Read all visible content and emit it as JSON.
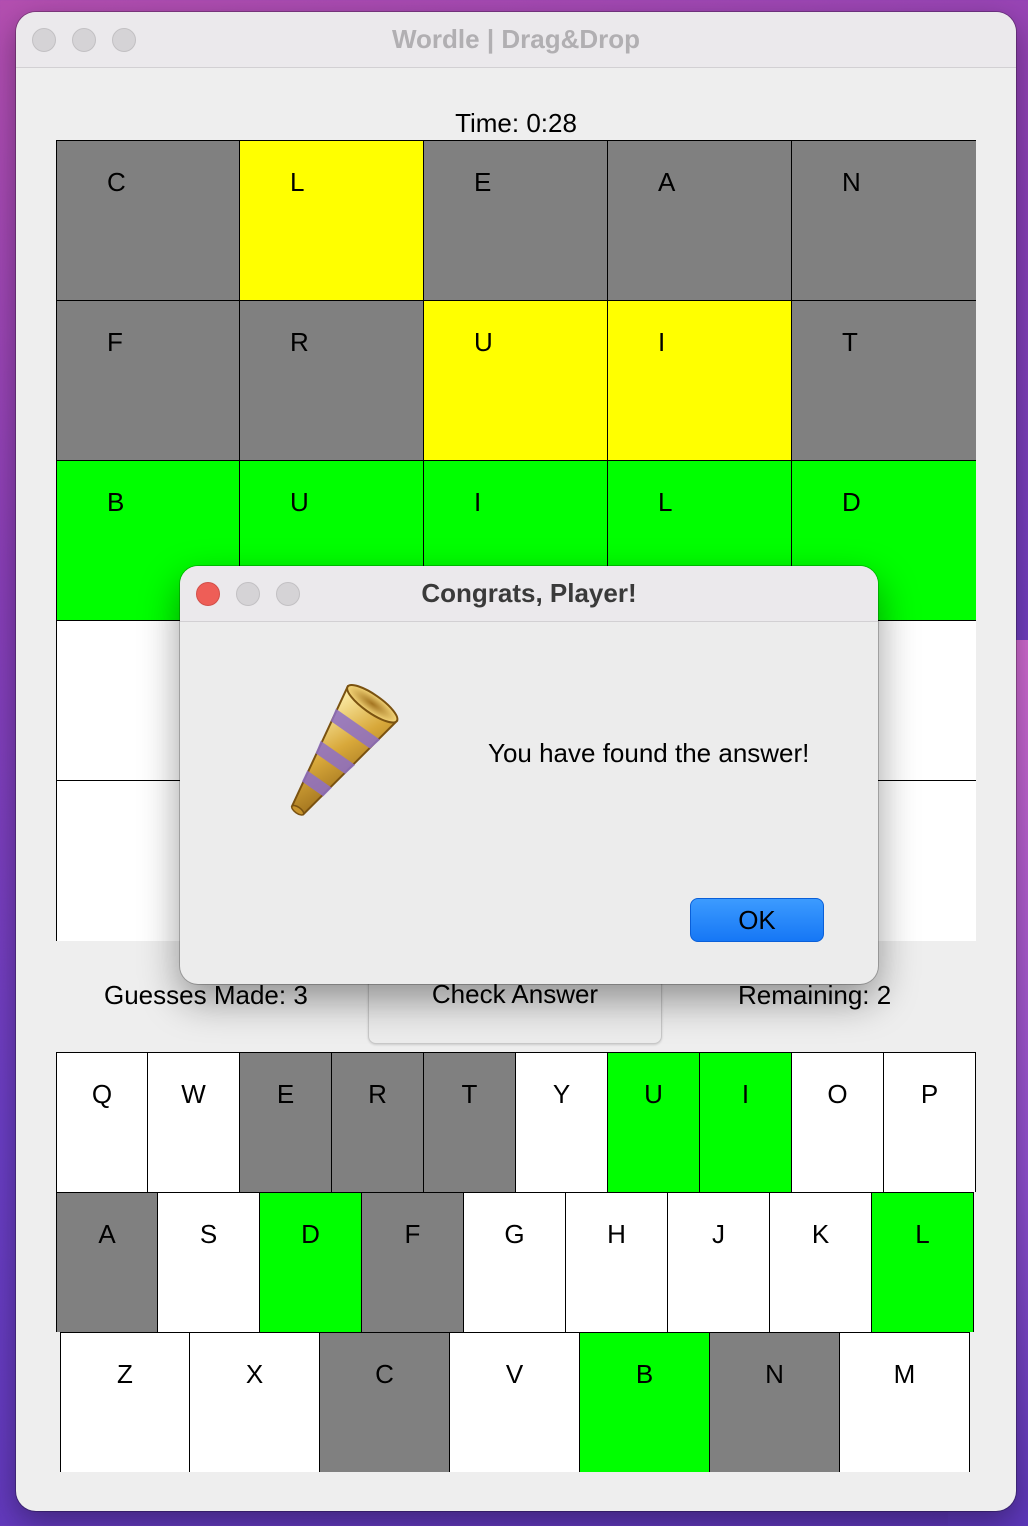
{
  "window": {
    "title": "Wordle | Drag&Drop"
  },
  "timer": {
    "label": "Time: 0:28"
  },
  "board": {
    "rows": [
      [
        {
          "letter": "C",
          "state": "gray"
        },
        {
          "letter": "L",
          "state": "yellow"
        },
        {
          "letter": "E",
          "state": "gray"
        },
        {
          "letter": "A",
          "state": "gray"
        },
        {
          "letter": "N",
          "state": "gray"
        }
      ],
      [
        {
          "letter": "F",
          "state": "gray"
        },
        {
          "letter": "R",
          "state": "gray"
        },
        {
          "letter": "U",
          "state": "yellow"
        },
        {
          "letter": "I",
          "state": "yellow"
        },
        {
          "letter": "T",
          "state": "gray"
        }
      ],
      [
        {
          "letter": "B",
          "state": "green"
        },
        {
          "letter": "U",
          "state": "green"
        },
        {
          "letter": "I",
          "state": "green"
        },
        {
          "letter": "L",
          "state": "green"
        },
        {
          "letter": "D",
          "state": "green"
        }
      ],
      [
        {
          "letter": "",
          "state": "white"
        },
        {
          "letter": "",
          "state": "white"
        },
        {
          "letter": "",
          "state": "white"
        },
        {
          "letter": "",
          "state": "white"
        },
        {
          "letter": "",
          "state": "white"
        }
      ],
      [
        {
          "letter": "",
          "state": "white"
        },
        {
          "letter": "",
          "state": "white"
        },
        {
          "letter": "",
          "state": "white"
        },
        {
          "letter": "",
          "state": "white"
        },
        {
          "letter": "",
          "state": "white"
        }
      ]
    ]
  },
  "status": {
    "guesses": "Guesses Made: 3",
    "check_label": "Check Answer",
    "remaining": "Remaining: 2"
  },
  "keyboard": {
    "rows": [
      [
        {
          "key": "Q",
          "state": "white"
        },
        {
          "key": "W",
          "state": "white"
        },
        {
          "key": "E",
          "state": "gray"
        },
        {
          "key": "R",
          "state": "gray"
        },
        {
          "key": "T",
          "state": "gray"
        },
        {
          "key": "Y",
          "state": "white"
        },
        {
          "key": "U",
          "state": "green"
        },
        {
          "key": "I",
          "state": "green"
        },
        {
          "key": "O",
          "state": "white"
        },
        {
          "key": "P",
          "state": "white"
        }
      ],
      [
        {
          "key": "A",
          "state": "gray"
        },
        {
          "key": "S",
          "state": "white"
        },
        {
          "key": "D",
          "state": "green"
        },
        {
          "key": "F",
          "state": "gray"
        },
        {
          "key": "G",
          "state": "white"
        },
        {
          "key": "H",
          "state": "white"
        },
        {
          "key": "J",
          "state": "white"
        },
        {
          "key": "K",
          "state": "white"
        },
        {
          "key": "L",
          "state": "green"
        }
      ],
      [
        {
          "key": "Z",
          "state": "white"
        },
        {
          "key": "X",
          "state": "white"
        },
        {
          "key": "C",
          "state": "gray"
        },
        {
          "key": "V",
          "state": "white"
        },
        {
          "key": "B",
          "state": "green"
        },
        {
          "key": "N",
          "state": "gray"
        },
        {
          "key": "M",
          "state": "white"
        }
      ]
    ]
  },
  "dialog": {
    "title": "Congrats, Player!",
    "message": "You have found the answer!",
    "ok_label": "OK",
    "icon": "party-horn-icon"
  },
  "colors": {
    "gray": "#808080",
    "yellow": "#ffff00",
    "green": "#00ff00",
    "white": "#ffffff",
    "ok_button": "#1677f5",
    "close_button": "#ee5e57"
  }
}
